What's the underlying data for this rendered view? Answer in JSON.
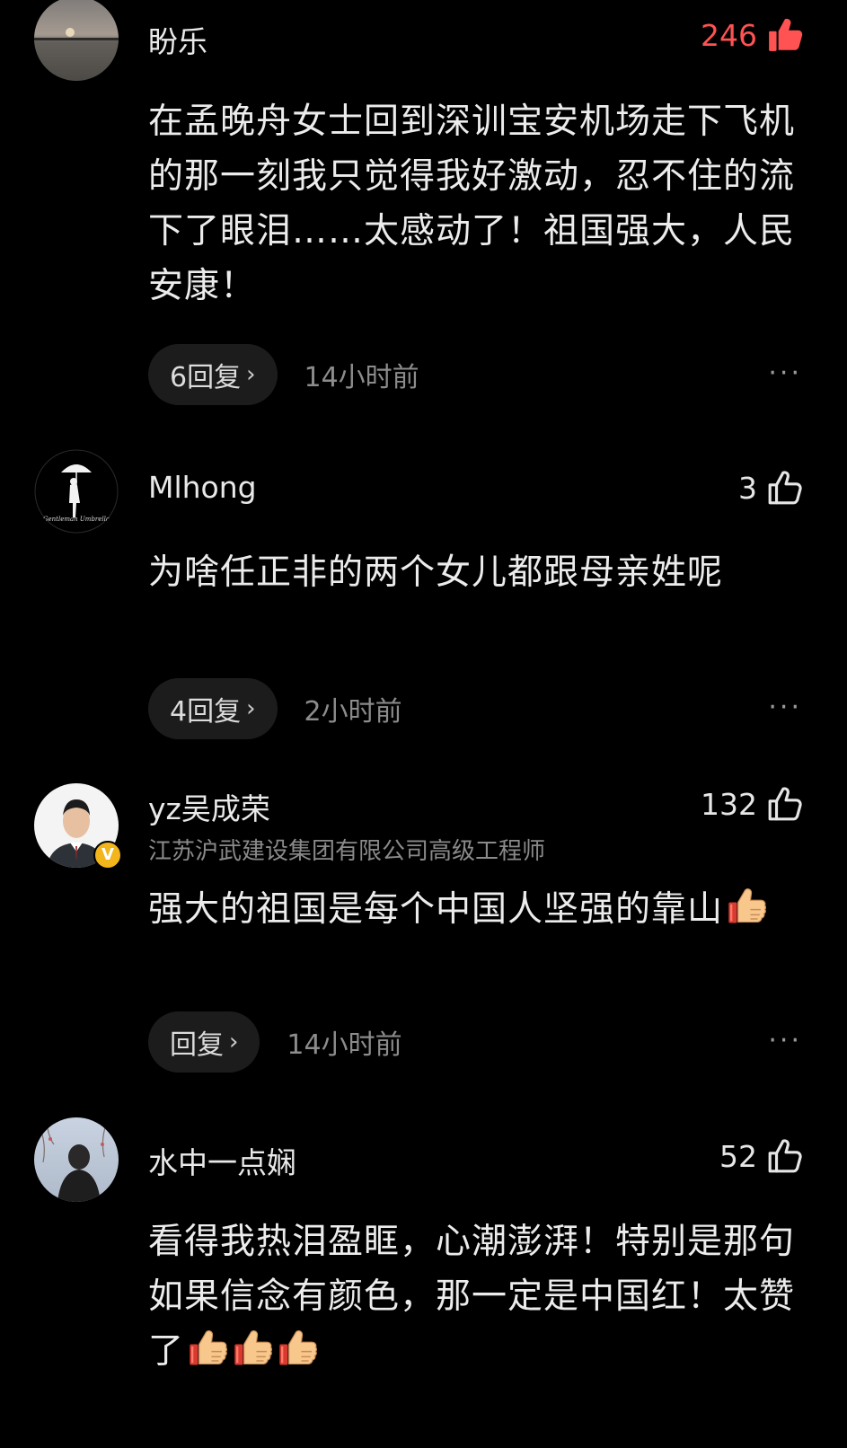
{
  "colors": {
    "background": "#000000",
    "hot_like": "#ff5252",
    "verified_badge": "#f2b51c"
  },
  "comments": [
    {
      "username": "盼乐",
      "likes": "246",
      "like_state": "liked-hot",
      "text": "在孟晚舟女士回到深训宝安机场走下飞机的那一刻我只觉得我好激动，忍不住的流下了眼泪……太感动了！祖国强大，人民安康！",
      "reply_label": "6回复",
      "time": "14小时前",
      "avatar": "lake-sunset-avatar"
    },
    {
      "username": "Mlhong",
      "likes": "3",
      "like_state": "outline",
      "text": "为啥任正非的两个女儿都跟母亲姓呢",
      "reply_label": "4回复",
      "time": "2小时前",
      "avatar": "umbrella-silhouette-avatar",
      "avatar_caption": "Gentleman Umbrella"
    },
    {
      "username": "yz吴成荣",
      "subtitle": "江苏沪武建设集团有限公司高级工程师",
      "verified": "V",
      "likes": "132",
      "like_state": "outline",
      "text": "强大的祖国是每个中国人坚强的靠山",
      "emoji_count": 1,
      "reply_label": "回复",
      "time": "14小时前",
      "avatar": "man-in-suit-avatar"
    },
    {
      "username": "水中一点娴",
      "likes": "52",
      "like_state": "outline",
      "text": "看得我热泪盈眶，心潮澎湃！特别是那句如果信念有颜色，那一定是中国红！太赞了",
      "emoji_count": 3,
      "avatar": "winter-girl-avatar"
    }
  ],
  "ui": {
    "reply_chevron": "›",
    "more_icon": "···"
  }
}
